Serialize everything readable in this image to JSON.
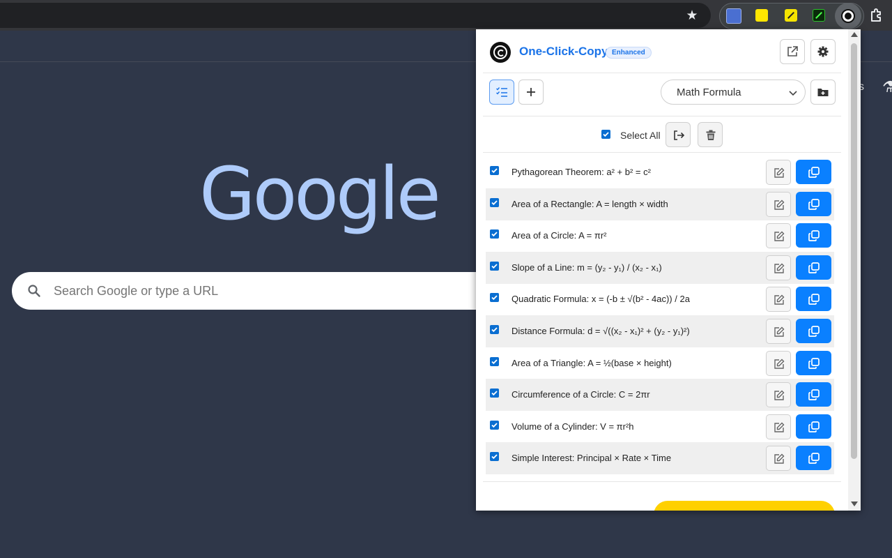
{
  "browser": {
    "star_icon": "★"
  },
  "ntp": {
    "logo_text": "Google",
    "search_placeholder": "Search Google or type a URL",
    "fragment_1": "s",
    "fragment_2": "⚗"
  },
  "popup": {
    "title": "One-Click-Copy",
    "badge": "Enhanced",
    "category_select": "Math Formula",
    "select_all_label": "Select All",
    "accent_color": "#1a73e8",
    "copy_button_color": "#0a80ff",
    "items": [
      {
        "text": "Pythagorean Theorem: a² + b² = c²",
        "checked": true
      },
      {
        "text": "Area of a Rectangle: A = length × width",
        "checked": true
      },
      {
        "text": "Area of a Circle: A = πr²",
        "checked": true
      },
      {
        "text": "Slope of a Line: m = (y₂ - y₁) / (x₂ - x₁)",
        "checked": true
      },
      {
        "text": "Quadratic Formula: x = (-b ± √(b² - 4ac)) / 2a",
        "checked": true
      },
      {
        "text": "Distance Formula: d = √((x₂ - x₁)² + (y₂ - y₁)²)",
        "checked": true
      },
      {
        "text": "Area of a Triangle: A = ½(base × height)",
        "checked": true
      },
      {
        "text": "Circumference of a Circle: C = 2πr",
        "checked": true
      },
      {
        "text": "Volume of a Cylinder: V = πr²h",
        "checked": true
      },
      {
        "text": "Simple Interest: Principal × Rate × Time",
        "checked": true
      }
    ]
  }
}
